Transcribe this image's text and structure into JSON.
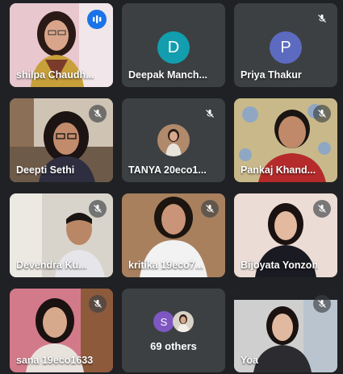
{
  "tiles": [
    {
      "name": "shilpa Chaudh..."
    },
    {
      "name": "Deepak Manch...",
      "initial": "D",
      "avatar_color": "#129eaf"
    },
    {
      "name": "Priya Thakur",
      "initial": "P",
      "avatar_color": "#5c6bc0"
    },
    {
      "name": "Deepti Sethi"
    },
    {
      "name": "TANYA 20eco1..."
    },
    {
      "name": "Pankaj Khand..."
    },
    {
      "name": "Devendra Ku..."
    },
    {
      "name": "kritika 19eco7..."
    },
    {
      "name": "Bijoyata Yonzon"
    },
    {
      "name": "sana 19eco1633"
    },
    {
      "name": "69 others",
      "initial": "S",
      "avatar_color": "#7e57c2"
    },
    {
      "name": "Yoa"
    }
  ],
  "colors": {
    "background": "#202124",
    "tile": "#3c4043",
    "active_outline": "#8ab4f8",
    "speaking": "#1a73e8"
  }
}
